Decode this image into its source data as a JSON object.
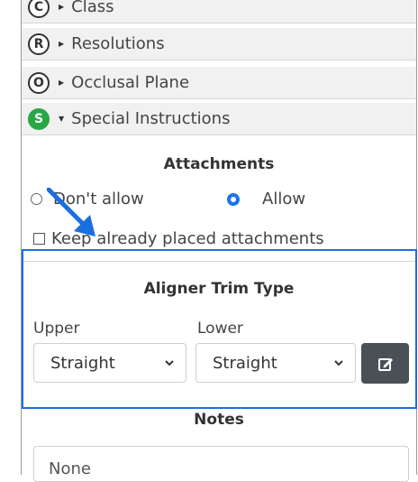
{
  "sections": [
    {
      "badge": "C",
      "label": "Class",
      "active": false
    },
    {
      "badge": "R",
      "label": "Resolutions",
      "active": false
    },
    {
      "badge": "O",
      "label": "Occlusal Plane",
      "active": false
    },
    {
      "badge": "S",
      "label": "Special Instructions",
      "active": true
    }
  ],
  "attachments": {
    "title": "Attachments",
    "options": [
      {
        "label": "Don't allow",
        "checked": false
      },
      {
        "label": "Allow",
        "checked": true
      }
    ],
    "keep_label": "Keep already placed attachments",
    "keep_checked": false
  },
  "trim": {
    "title": "Aligner Trim Type",
    "upper_label": "Upper",
    "lower_label": "Lower",
    "upper_value": "Straight",
    "lower_value": "Straight"
  },
  "notes": {
    "title": "Notes",
    "value": "None"
  },
  "icons": {
    "edit": "edit-icon",
    "chevron": "chevron-down-icon",
    "annotation": "arrow-annotation"
  },
  "colors": {
    "active_badge": "#28a745",
    "radio_checked": "#1a73e8",
    "highlight": "#1a6fe0",
    "edit_button": "#4a5156"
  }
}
